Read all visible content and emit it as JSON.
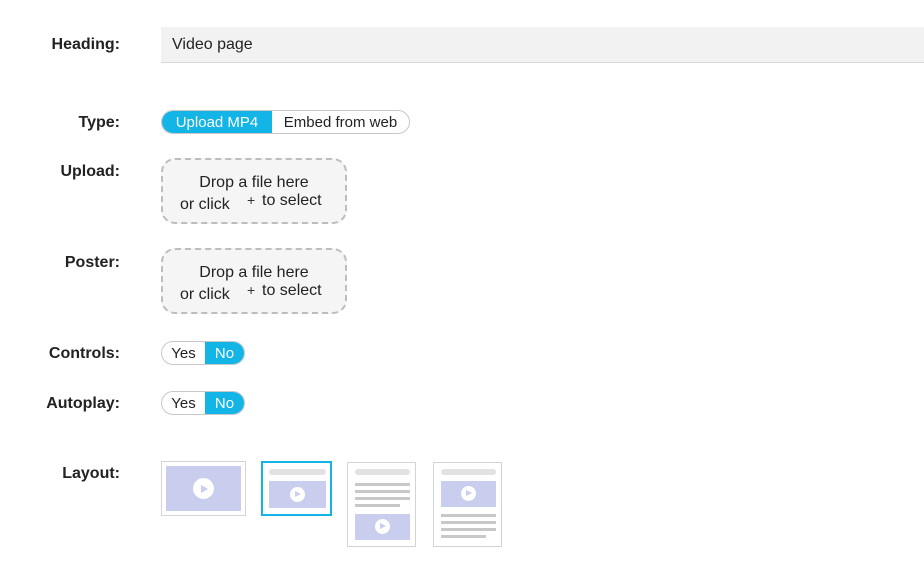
{
  "form": {
    "heading": {
      "label": "Heading:",
      "value": "Video page"
    },
    "type": {
      "label": "Type:",
      "options": [
        "Upload MP4",
        "Embed from web"
      ],
      "selected": "Upload MP4"
    },
    "upload": {
      "label": "Upload:",
      "line1": "Drop a file here",
      "line2a": "or click",
      "plus": "+",
      "line2b": "to select"
    },
    "poster": {
      "label": "Poster:",
      "line1": "Drop a file here",
      "line2a": "or click",
      "plus": "+",
      "line2b": "to select"
    },
    "controls": {
      "label": "Controls:",
      "yes": "Yes",
      "no": "No",
      "selected": "No"
    },
    "autoplay": {
      "label": "Autoplay:",
      "yes": "Yes",
      "no": "No",
      "selected": "No"
    },
    "layout": {
      "label": "Layout:",
      "options": [
        "video-only",
        "heading-video",
        "text-then-video",
        "video-then-text"
      ],
      "selected": "heading-video"
    }
  },
  "colors": {
    "accent": "#13b4e6",
    "video_placeholder": "#c9cdee",
    "dropzone_bg": "#f5f5f5"
  },
  "icons": [
    "play-icon",
    "plus-icon"
  ]
}
